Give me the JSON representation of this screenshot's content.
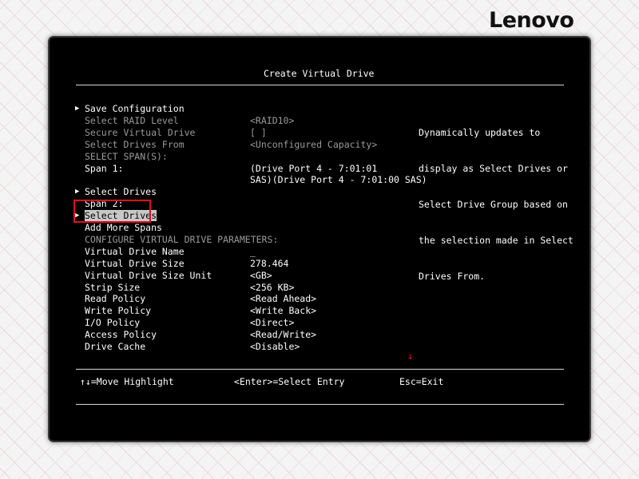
{
  "brand": {
    "logo_text": "Lenovo"
  },
  "screen": {
    "title": "Create Virtual Drive"
  },
  "items": [
    {
      "label": "Save Configuration",
      "value": "",
      "arrow": true,
      "dim": false,
      "interactable": true,
      "name": "menu-item-save-configuration"
    },
    {
      "label": "Select RAID Level",
      "value": "<RAID10>",
      "arrow": false,
      "dim": true,
      "interactable": false,
      "name": "field-select-raid-level"
    },
    {
      "label": "Secure Virtual Drive",
      "value": "[ ]",
      "arrow": false,
      "dim": true,
      "interactable": false,
      "name": "field-secure-virtual-drive"
    },
    {
      "label": "Select Drives From",
      "value": "<Unconfigured Capacity>",
      "arrow": false,
      "dim": true,
      "interactable": false,
      "name": "field-select-drives-from"
    },
    {
      "label": "SELECT SPAN(S):",
      "value": "",
      "arrow": false,
      "dim": true,
      "interactable": false,
      "name": "section-select-spans"
    },
    {
      "label": "Span 1:",
      "value": "(Drive Port 4 - 7:01:01",
      "arrow": false,
      "dim": false,
      "interactable": false,
      "name": "field-span-1"
    },
    {
      "label": "",
      "value": "SAS)(Drive Port 4 - 7:01:00 SAS)",
      "arrow": false,
      "dim": false,
      "interactable": false,
      "name": "field-span-1-continued"
    },
    {
      "label": "Select Drives",
      "value": "",
      "arrow": true,
      "dim": false,
      "interactable": true,
      "name": "menu-item-select-drives-span-1"
    },
    {
      "label": "Span 2:",
      "value": "",
      "arrow": false,
      "dim": false,
      "interactable": false,
      "name": "field-span-2"
    },
    {
      "label": "Select Drives",
      "value": "",
      "arrow": true,
      "dim": false,
      "interactable": true,
      "highlighted": true,
      "name": "menu-item-select-drives-span-2"
    },
    {
      "label": "Add More Spans",
      "value": "",
      "arrow": false,
      "dim": false,
      "interactable": true,
      "name": "menu-item-add-more-spans"
    },
    {
      "label": "CONFIGURE VIRTUAL DRIVE PARAMETERS:",
      "value": "",
      "arrow": false,
      "dim": true,
      "interactable": false,
      "name": "section-configure-parameters"
    },
    {
      "label": "Virtual Drive Name",
      "value": "_",
      "arrow": false,
      "dim": false,
      "interactable": true,
      "name": "field-virtual-drive-name"
    },
    {
      "label": "Virtual Drive Size",
      "value": "278.464",
      "arrow": false,
      "dim": false,
      "interactable": true,
      "name": "field-virtual-drive-size"
    },
    {
      "label": "Virtual Drive Size Unit",
      "value": "<GB>",
      "arrow": false,
      "dim": false,
      "interactable": true,
      "name": "field-virtual-drive-size-unit"
    },
    {
      "label": "Strip Size",
      "value": "<256 KB>",
      "arrow": false,
      "dim": false,
      "interactable": true,
      "name": "field-strip-size"
    },
    {
      "label": "Read Policy",
      "value": "<Read Ahead>",
      "arrow": false,
      "dim": false,
      "interactable": true,
      "name": "field-read-policy"
    },
    {
      "label": "Write Policy",
      "value": "<Write Back>",
      "arrow": false,
      "dim": false,
      "interactable": true,
      "name": "field-write-policy"
    },
    {
      "label": "I/O Policy",
      "value": "<Direct>",
      "arrow": false,
      "dim": false,
      "interactable": true,
      "name": "field-io-policy"
    },
    {
      "label": "Access Policy",
      "value": "<Read/Write>",
      "arrow": false,
      "dim": false,
      "interactable": true,
      "name": "field-access-policy"
    },
    {
      "label": "Drive Cache",
      "value": "<Disable>",
      "arrow": false,
      "dim": false,
      "interactable": true,
      "name": "field-drive-cache"
    }
  ],
  "help": {
    "lines": [
      "Dynamically updates to",
      "display as Select Drives or",
      "Select Drive Group based on",
      "the selection made in Select",
      "Drives From."
    ]
  },
  "footer": {
    "move": "↑↓=Move Highlight",
    "select": "<Enter>=Select Entry",
    "exit": "Esc=Exit"
  },
  "scroll_indicator": "↓",
  "colors": {
    "screen_bg": "#000000",
    "text": "#ffffff",
    "dim_text": "#9a9a9a",
    "highlight_bg": "#c8c8c8",
    "callout": "#e0101e"
  }
}
